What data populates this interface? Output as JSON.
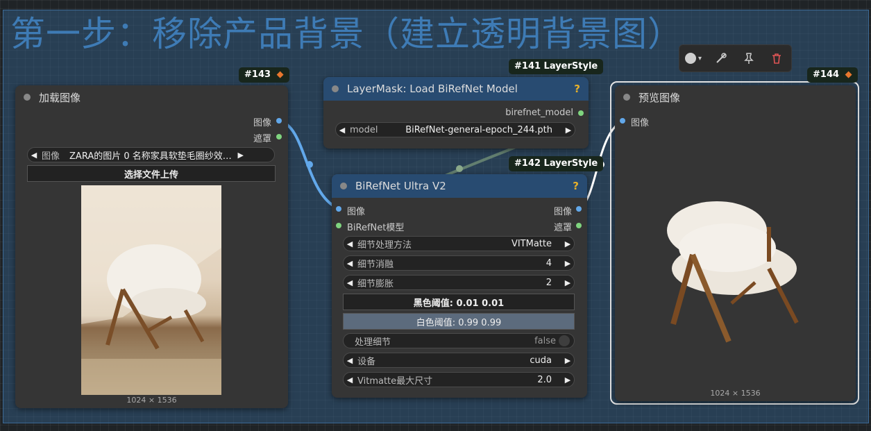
{
  "group": {
    "title": "第一步：移除产品背景（建立透明背景图）"
  },
  "toolbar": {
    "color_icon": "circle-icon",
    "caret": "▾",
    "delete_color": "#e05555"
  },
  "nodes": {
    "load_image": {
      "badge": "#143",
      "title": "加载图像",
      "outputs": [
        "图像",
        "遮罩"
      ],
      "image_widget": {
        "label": "图像",
        "value": "ZARA的图片 0 名称家具软垫毛圈纱效…"
      },
      "upload_label": "选择文件上传",
      "dimensions": "1024 × 1536"
    },
    "load_birefnet": {
      "badge": "#141 LayerStyle",
      "title": "LayerMask: Load BiRefNet Model",
      "help": "?",
      "output": "birefnet_model",
      "model_widget": {
        "label": "model",
        "value": "BiRefNet-general-epoch_244.pth"
      }
    },
    "birefnet_ultra": {
      "badge": "#142 LayerStyle",
      "title": "BiRefNet Ultra V2",
      "help": "?",
      "inputs": [
        "图像",
        "BiRefNet模型"
      ],
      "outputs": [
        "图像",
        "遮罩"
      ],
      "widgets": [
        {
          "label": "细节处理方法",
          "value": "VITMatte"
        },
        {
          "label": "细节消融",
          "value": "4"
        },
        {
          "label": "细节膨胀",
          "value": "2"
        }
      ],
      "black_threshold": "黑色阈值: 0.01  0.01",
      "white_threshold": "白色阈值: 0.99  0.99",
      "toggle": {
        "label": "处理细节",
        "value": "false"
      },
      "widgets2": [
        {
          "label": "设备",
          "value": "cuda"
        },
        {
          "label": "Vitmatte最大尺寸",
          "value": "2.0"
        }
      ]
    },
    "preview": {
      "badge": "#144",
      "title": "预览图像",
      "input": "图像",
      "dimensions": "1024 × 1536"
    }
  }
}
